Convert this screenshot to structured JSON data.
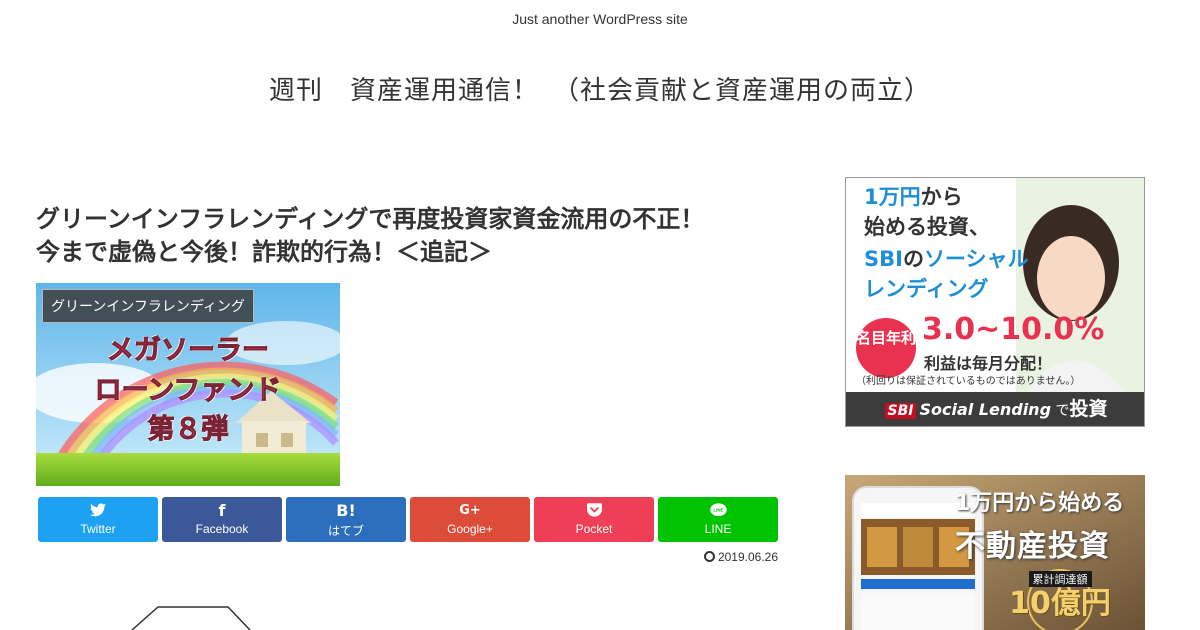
{
  "header": {
    "tagline": "Just another WordPress site",
    "site_title": "週刊　資産運用通信！　（社会貢献と資産運用の両立）"
  },
  "article": {
    "title_line1": "グリーンインフラレンディングで再度投資家資金流用の不正！",
    "title_line2": "今まで虚偽と今後！詐欺的行為！＜追記＞",
    "category": "グリーンインフラレンディング",
    "eyecatch_text": [
      "メガソーラー",
      "ローンファンド",
      "第８弾"
    ],
    "date": "2019.06.26"
  },
  "share": {
    "buttons": [
      {
        "label": "Twitter",
        "icon": "twitter-icon",
        "color": "#1da1f2"
      },
      {
        "label": "Facebook",
        "icon": "facebook-icon",
        "color": "#3b5998"
      },
      {
        "label": "はてブ",
        "icon": "hatena-icon",
        "color": "#2c6ebd"
      },
      {
        "label": "Google+",
        "icon": "google-plus-icon",
        "color": "#dd4b39"
      },
      {
        "label": "Pocket",
        "icon": "pocket-icon",
        "color": "#ef3f56"
      },
      {
        "label": "LINE",
        "icon": "line-icon",
        "color": "#00c300"
      }
    ]
  },
  "sidebar": {
    "ad1": {
      "line1a": "1万円",
      "line1b": "から",
      "line2": "始める投資、",
      "line3a": "SBI",
      "line3b": "の",
      "line3c": "ソーシャル",
      "line4": "レンディング",
      "circle": "名目年利",
      "rate": "3.0~10.0%",
      "sub": "利益は毎月分配！",
      "note": "（利回りは保証されているものではありません。）",
      "bar_sbi": "SBI",
      "bar_text": "Social Lending",
      "bar_de": "で",
      "bar_big": "投資"
    },
    "ad2": {
      "line1": "1万円から始める",
      "line2": "不動産投資",
      "badge_small": "累計調達額",
      "badge_big": "10億円"
    }
  }
}
